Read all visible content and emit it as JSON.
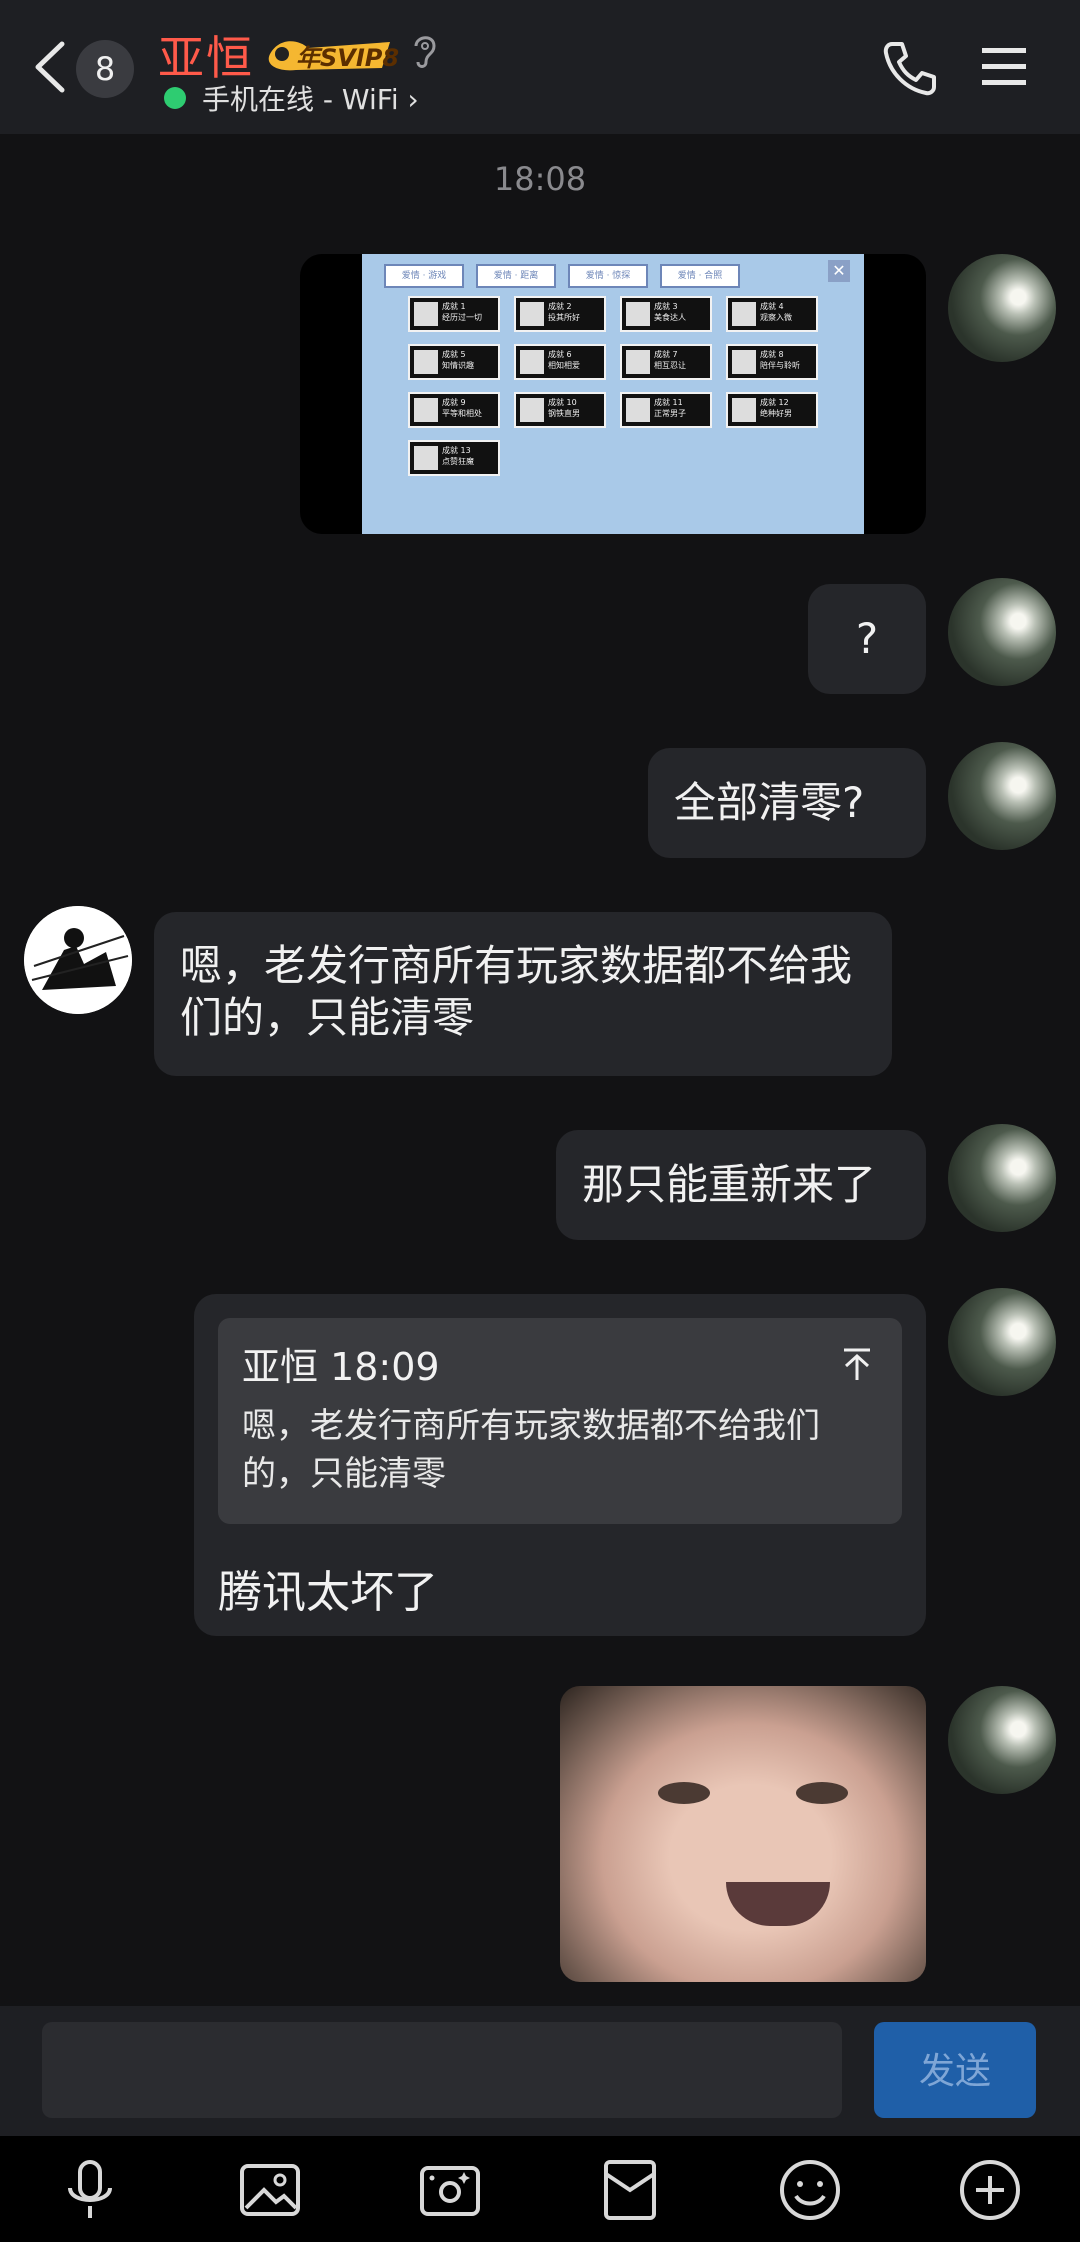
{
  "header": {
    "unread_count": "8",
    "contact_name": "亚恒",
    "svip_badge": "年SVIP8",
    "status": "手机在线 - WiFi",
    "status_color": "#2ecc71",
    "name_color": "#ff5a4a",
    "icons": [
      "back-icon",
      "ear-icon",
      "call-icon",
      "menu-icon"
    ]
  },
  "chat": {
    "timestamp": "18:08",
    "game_screenshot": {
      "tabs": [
        "爱情 · 游戏",
        "爱情 · 距离",
        "爱情 · 惊探",
        "爱情 · 合照"
      ],
      "achievements": [
        {
          "name": "成就 1",
          "desc": "经历过一切"
        },
        {
          "name": "成就 2",
          "desc": "投其所好"
        },
        {
          "name": "成就 3",
          "desc": "美食达人"
        },
        {
          "name": "成就 4",
          "desc": "观察入微"
        },
        {
          "name": "成就 5",
          "desc": "知情识趣"
        },
        {
          "name": "成就 6",
          "desc": "相知相爱"
        },
        {
          "name": "成就 7",
          "desc": "相互忍让"
        },
        {
          "name": "成就 8",
          "desc": "陪伴与聆听"
        },
        {
          "name": "成就 9",
          "desc": "平等和相处"
        },
        {
          "name": "成就 10",
          "desc": "钢铁直男"
        },
        {
          "name": "成就 11",
          "desc": "正常男子"
        },
        {
          "name": "成就 12",
          "desc": "绝种好男"
        },
        {
          "name": "成就 13",
          "desc": "点赞狂魔"
        }
      ]
    },
    "messages": {
      "question": "?",
      "reset_question": "全部清零?",
      "reply": "嗯，老发行商所有玩家数据都不给我们的，只能清零",
      "restart": "那只能重新来了",
      "quote_author_time": "亚恒 18:09",
      "quote_text": "嗯，老发行商所有玩家数据都不给我们的，只能清零",
      "tencent": "腾讯太坏了"
    }
  },
  "input": {
    "value": "",
    "send_label": "发送"
  },
  "toolbar": {
    "icons": [
      "microphone-icon",
      "image-icon",
      "camera-icon",
      "red-packet-icon",
      "emoji-icon",
      "plus-icon"
    ]
  }
}
